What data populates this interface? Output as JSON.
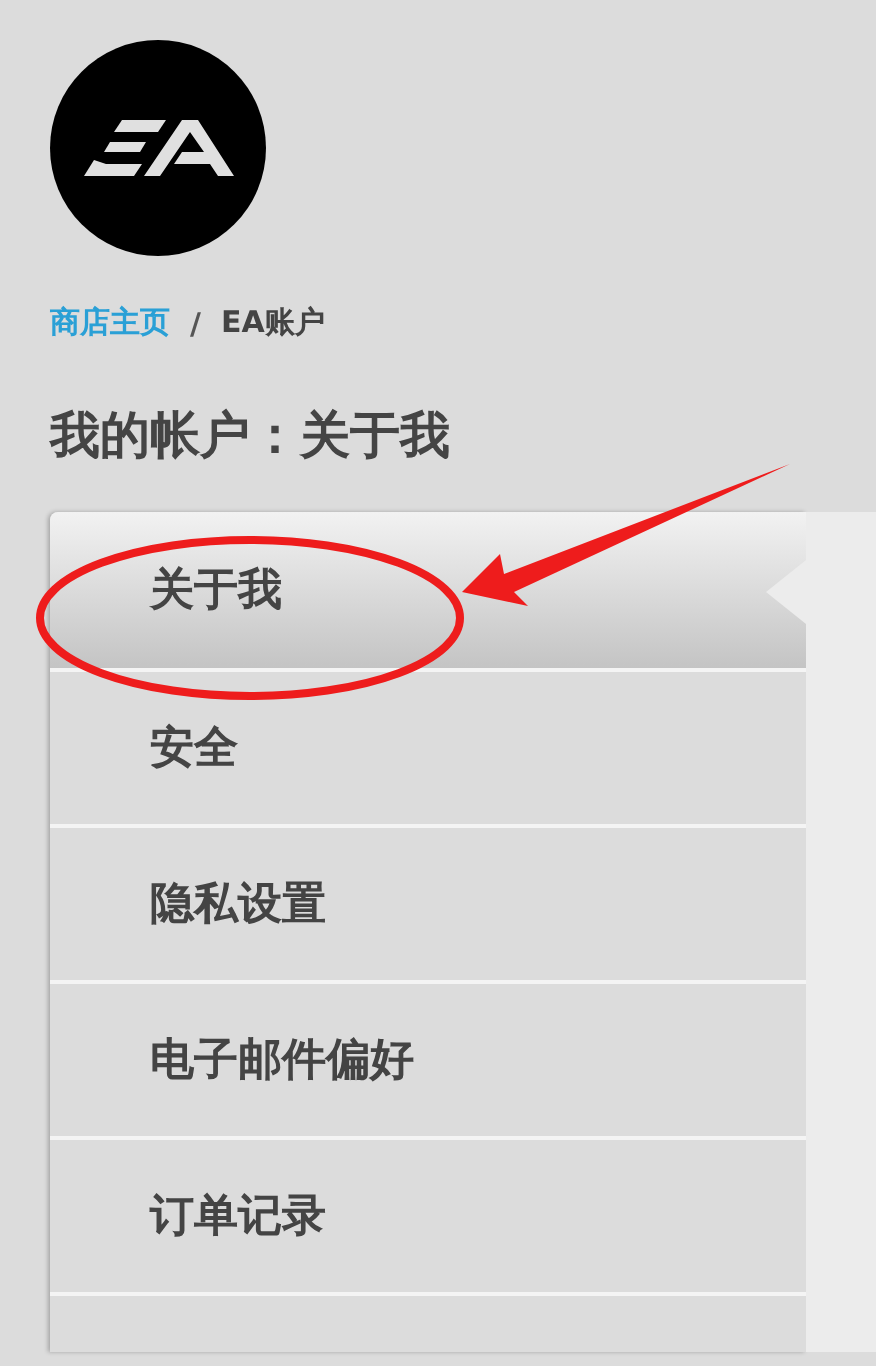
{
  "breadcrumb": [
    {
      "label": "商店主页",
      "kind": "link"
    },
    {
      "label": "/",
      "kind": "separator"
    },
    {
      "label": "EA账户",
      "kind": "current"
    }
  ],
  "heading": "我的帐户：关于我",
  "menu": [
    {
      "label": "关于我",
      "selected": true
    },
    {
      "label": "安全",
      "selected": false
    },
    {
      "label": "隐私设置",
      "selected": false
    },
    {
      "label": "电子邮件偏好",
      "selected": false
    },
    {
      "label": "订单记录",
      "selected": false
    }
  ]
}
